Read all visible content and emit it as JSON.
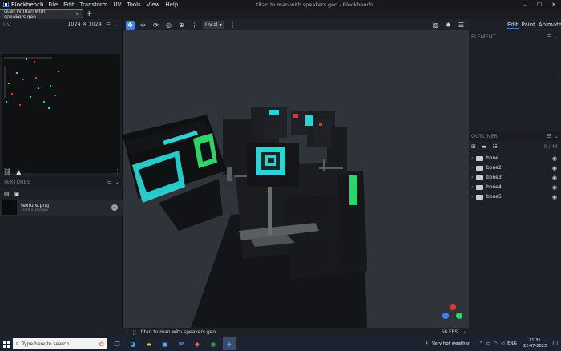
{
  "app": {
    "name": "Blockbench",
    "menu": [
      "File",
      "Edit",
      "Transform",
      "UV",
      "Tools",
      "View",
      "Help"
    ],
    "window_title": "titan tv man with speakers.geo - Blockbench"
  },
  "tabs": [
    {
      "label": "titan tv man with speakers.geo"
    }
  ],
  "uv_panel": {
    "title": "UV",
    "resolution": "1024 ✕ 1024"
  },
  "textures_panel": {
    "title": "TEXTURES",
    "texture": {
      "name": "texture.png",
      "size": "1024 x 1024px"
    }
  },
  "viewport": {
    "transform_space": "Local",
    "status_file": "titan tv man with speakers.geo",
    "fps": "56 FPS"
  },
  "right_panel": {
    "modes": [
      "Edit",
      "Paint",
      "Animate"
    ],
    "element_title": "ELEMENT",
    "outliner_title": "OUTLINER",
    "outliner_count": "0 / 44",
    "bones": [
      "bone",
      "bone2",
      "bone3",
      "bone4",
      "bone5"
    ]
  },
  "taskbar": {
    "search_placeholder": "Type here to search",
    "weather": "Very hot weather",
    "lang": "ENG",
    "time": "11:31",
    "date": "22-07-2023"
  },
  "colors": {
    "accent": "#3b82f6",
    "cyan": "#2ad4d4",
    "green": "#2fd36b"
  }
}
